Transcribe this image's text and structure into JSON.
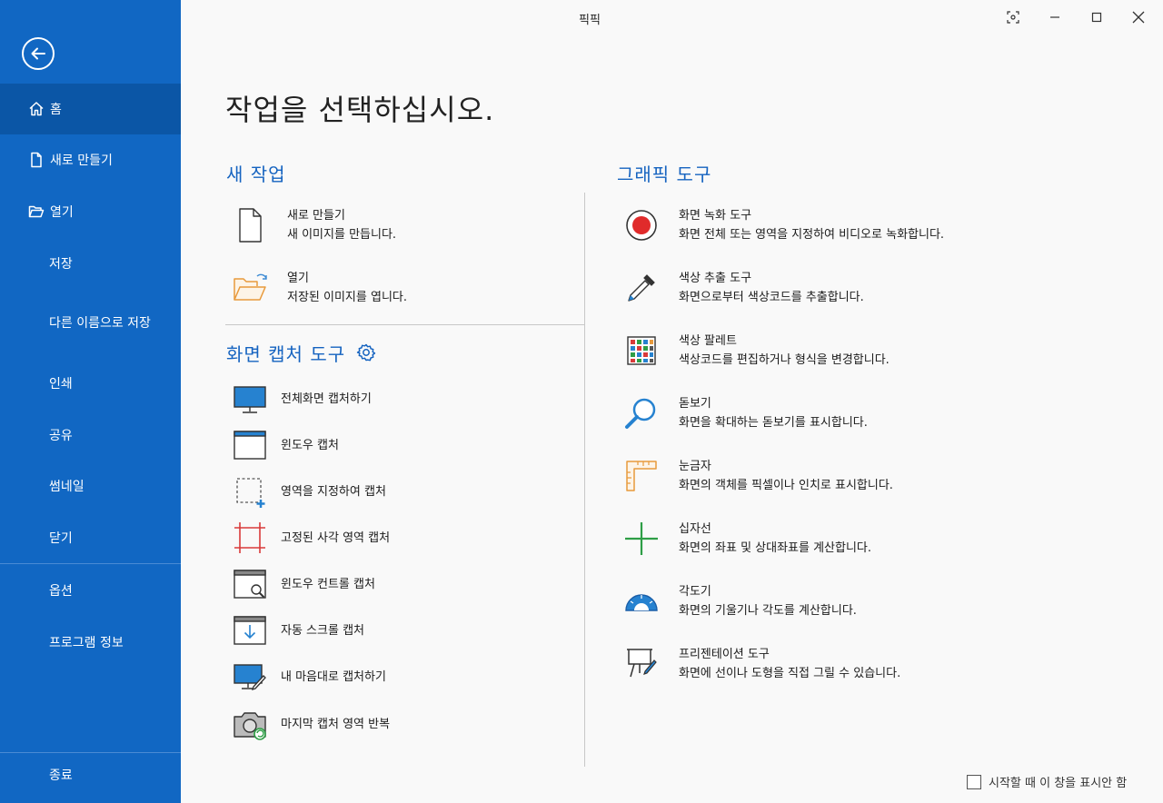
{
  "app": {
    "title": "픽픽"
  },
  "sidebar": {
    "items": [
      {
        "label": "홈",
        "icon": "home-icon",
        "active": true
      },
      {
        "label": "새로 만들기",
        "icon": "new-file-icon"
      },
      {
        "label": "열기",
        "icon": "folder-open-icon"
      },
      {
        "label": "저장"
      },
      {
        "label": "다른 이름으로 저장"
      },
      {
        "label": "인쇄"
      },
      {
        "label": "공유"
      },
      {
        "label": "썸네일"
      },
      {
        "label": "닫기"
      },
      {
        "label": "옵션"
      },
      {
        "label": "프로그램 정보"
      },
      {
        "label": "종료"
      }
    ]
  },
  "main": {
    "heading": "작업을 선택하십시오.",
    "new_task": {
      "title": "새 작업",
      "items": [
        {
          "title": "새로 만들기",
          "desc": "새 이미지를 만듭니다."
        },
        {
          "title": "열기",
          "desc": "저장된 이미지를 엽니다."
        }
      ]
    },
    "capture": {
      "title": "화면 캡처 도구",
      "items": [
        {
          "label": "전체화면 캡처하기"
        },
        {
          "label": "윈도우 캡처"
        },
        {
          "label": "영역을 지정하여 캡처"
        },
        {
          "label": "고정된 사각 영역 캡처"
        },
        {
          "label": "윈도우 컨트롤 캡처"
        },
        {
          "label": "자동 스크롤 캡처"
        },
        {
          "label": "내 마음대로 캡처하기"
        },
        {
          "label": "마지막 캡처 영역 반복"
        }
      ]
    },
    "graphic": {
      "title": "그래픽 도구",
      "items": [
        {
          "title": "화면 녹화 도구",
          "desc": "화면 전체 또는 영역을 지정하여 비디오로 녹화합니다."
        },
        {
          "title": "색상 추출 도구",
          "desc": "화면으로부터 색상코드를 추출합니다."
        },
        {
          "title": "색상 팔레트",
          "desc": "색상코드를 편집하거나 형식을 변경합니다."
        },
        {
          "title": "돋보기",
          "desc": "화면을 확대하는 돋보기를 표시합니다."
        },
        {
          "title": "눈금자",
          "desc": "화면의 객체를 픽셀이나 인치로 표시합니다."
        },
        {
          "title": "십자선",
          "desc": "화면의 좌표 및 상대좌표를 계산합니다."
        },
        {
          "title": "각도기",
          "desc": "화면의 기울기나 각도를 계산합니다."
        },
        {
          "title": "프리젠테이션 도구",
          "desc": "화면에 선이나 도형을 직접 그릴 수 있습니다."
        }
      ]
    },
    "startup_checkbox": {
      "label": "시작할 때 이 창을 표시안 함",
      "checked": false
    }
  },
  "colors": {
    "sidebar": "#1167c3",
    "sidebar_active": "#0b56a6",
    "accent": "#1563c0"
  }
}
